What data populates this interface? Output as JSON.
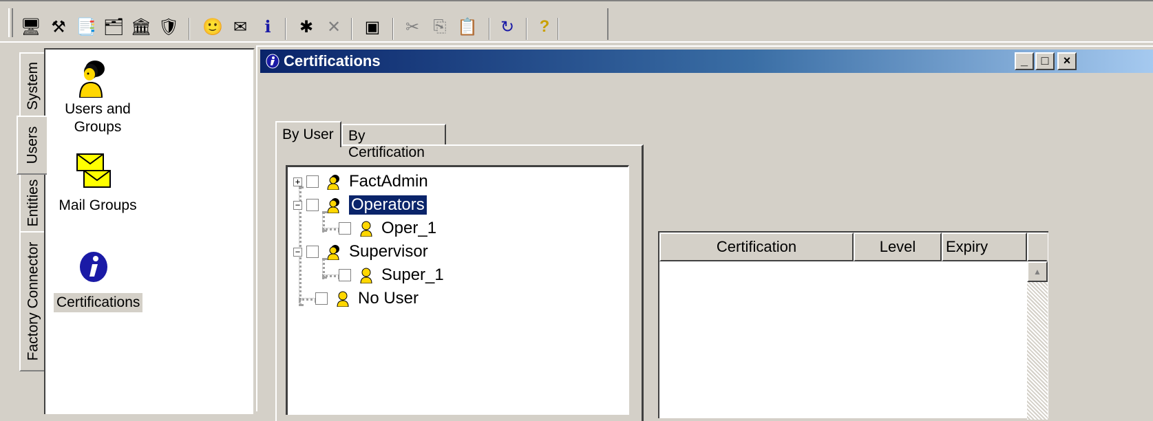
{
  "toolbar": {
    "buttons": [
      {
        "name": "whats-this-icon",
        "glyph": "🖥"
      },
      {
        "name": "tools-icon",
        "glyph": "⚒"
      },
      {
        "name": "copy-objects-icon",
        "glyph": "📑"
      },
      {
        "name": "hierarchy-icon",
        "glyph": "🗂"
      },
      {
        "name": "building-icon",
        "glyph": "🏛"
      },
      {
        "name": "shield-icon",
        "glyph": "🛡"
      },
      {
        "name": "user-icon",
        "glyph": "🙂"
      },
      {
        "name": "mail-icon",
        "glyph": "✉"
      },
      {
        "name": "info-icon",
        "glyph": "ℹ"
      },
      {
        "name": "gear-icon",
        "glyph": "✱"
      },
      {
        "name": "cross-icon",
        "glyph": "✕"
      },
      {
        "name": "window-icon",
        "glyph": "▣"
      },
      {
        "name": "cut-icon",
        "glyph": "✂"
      },
      {
        "name": "copy-icon",
        "glyph": "⎘"
      },
      {
        "name": "paste-icon",
        "glyph": "📋"
      },
      {
        "name": "refresh-icon",
        "glyph": "↻"
      },
      {
        "name": "help-icon",
        "glyph": "?"
      }
    ]
  },
  "sidebar": {
    "tabs": [
      "System",
      "Users",
      "Entities",
      "Factory Connector"
    ],
    "items": [
      {
        "label_line1": "Users and",
        "label_line2": "Groups"
      },
      {
        "label": "Mail Groups"
      },
      {
        "label": "Certifications"
      }
    ]
  },
  "window": {
    "title": "Certifications",
    "minimize": "_",
    "maximize": "□",
    "close": "×"
  },
  "tabs": [
    "By User",
    "By Certification"
  ],
  "tree": [
    {
      "label": "FactAdmin",
      "expander": "+"
    },
    {
      "label": "Operators",
      "expander": "−"
    },
    {
      "label": "Oper_1"
    },
    {
      "label": "Supervisor",
      "expander": "−"
    },
    {
      "label": "Super_1"
    },
    {
      "label": "No User"
    }
  ],
  "list": {
    "columns": [
      "Certification",
      "Level",
      "Expiry"
    ],
    "scroll_up": "▲"
  }
}
